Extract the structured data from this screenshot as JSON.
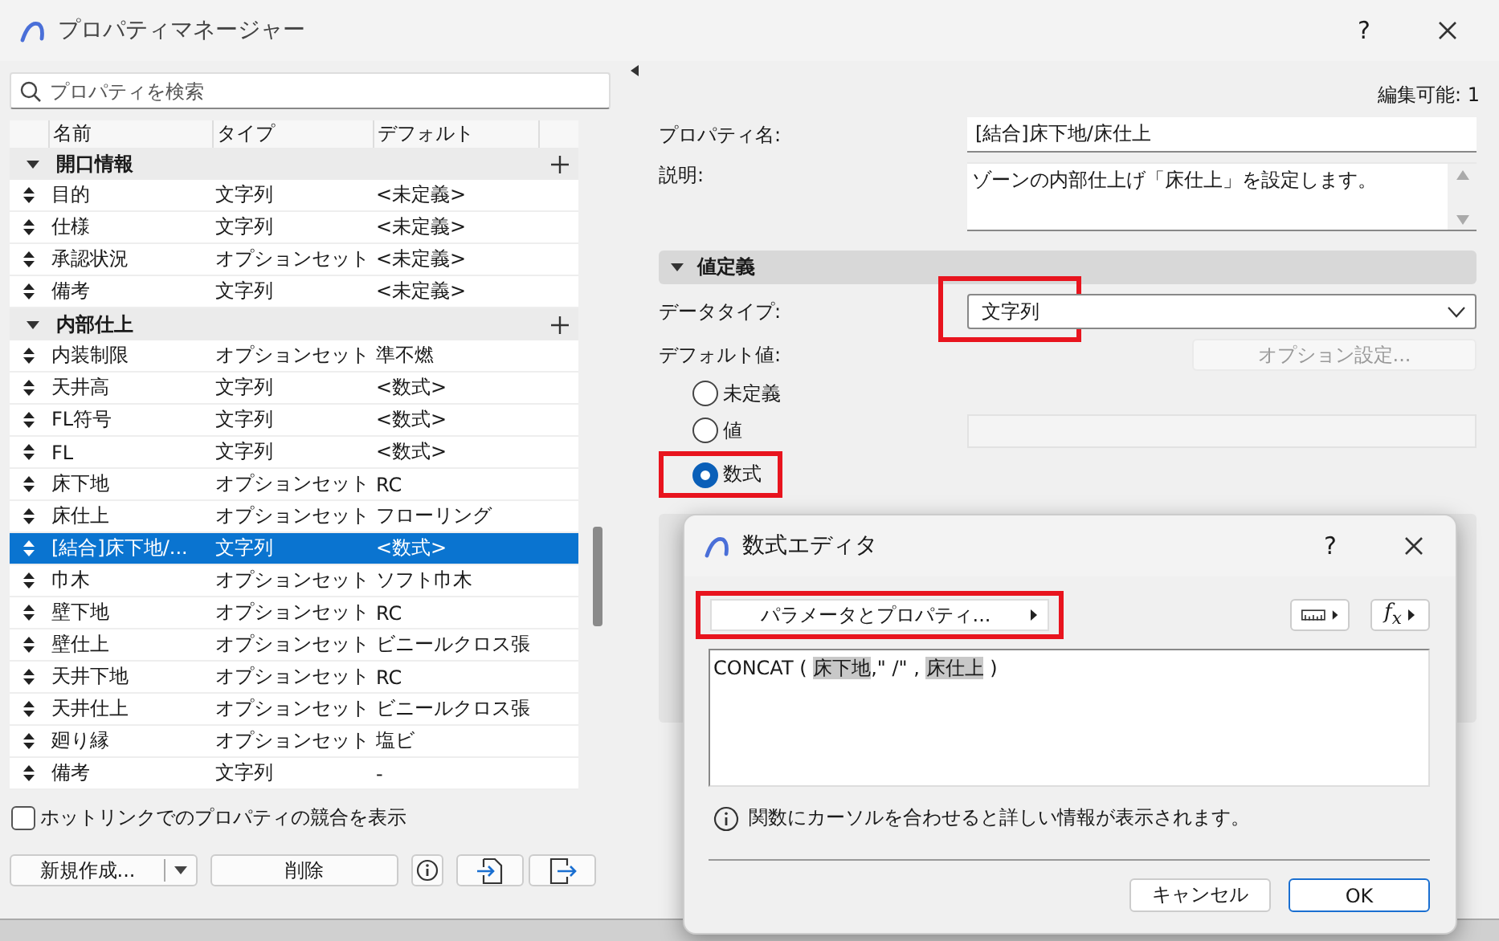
{
  "window": {
    "title": "プロパティマネージャー",
    "help": "?"
  },
  "search": {
    "placeholder": "プロパティを検索"
  },
  "table": {
    "columns": [
      "名前",
      "タイプ",
      "デフォルト"
    ],
    "groups": [
      {
        "name": "開口情報",
        "expanded": true,
        "rows": [
          {
            "name": "目的",
            "type": "文字列",
            "default": "<未定義>",
            "selected": false
          },
          {
            "name": "仕様",
            "type": "文字列",
            "default": "<未定義>",
            "selected": false
          },
          {
            "name": "承認状況",
            "type": "オプションセット",
            "default": "<未定義>",
            "selected": false
          },
          {
            "name": "備考",
            "type": "文字列",
            "default": "<未定義>",
            "selected": false
          }
        ]
      },
      {
        "name": "内部仕上",
        "expanded": true,
        "rows": [
          {
            "name": "内装制限",
            "type": "オプションセット",
            "default": "準不燃",
            "selected": false
          },
          {
            "name": "天井高",
            "type": "文字列",
            "default": "<数式>",
            "selected": false
          },
          {
            "name": "FL符号",
            "type": "文字列",
            "default": "<数式>",
            "selected": false
          },
          {
            "name": "FL",
            "type": "文字列",
            "default": "<数式>",
            "selected": false
          },
          {
            "name": "床下地",
            "type": "オプションセット",
            "default": "RC",
            "selected": false
          },
          {
            "name": "床仕上",
            "type": "オプションセット",
            "default": "フローリング",
            "selected": false
          },
          {
            "name": "[結合]床下地/...",
            "type": "文字列",
            "default": "<数式>",
            "selected": true
          },
          {
            "name": "巾木",
            "type": "オプションセット",
            "default": "ソフト巾木",
            "selected": false
          },
          {
            "name": "壁下地",
            "type": "オプションセット",
            "default": "RC",
            "selected": false
          },
          {
            "name": "壁仕上",
            "type": "オプションセット",
            "default": "ビニールクロス張",
            "selected": false
          },
          {
            "name": "天井下地",
            "type": "オプションセット",
            "default": "RC",
            "selected": false
          },
          {
            "name": "天井仕上",
            "type": "オプションセット",
            "default": "ビニールクロス張",
            "selected": false
          },
          {
            "name": "廻り縁",
            "type": "オプションセット",
            "default": "塩ビ",
            "selected": false
          },
          {
            "name": "備考",
            "type": "文字列",
            "default": "-",
            "selected": false
          }
        ]
      }
    ]
  },
  "hotlink_checkbox": {
    "label": "ホットリンクでのプロパティの競合を表示",
    "checked": false
  },
  "left_buttons": {
    "new": "新規作成...",
    "delete": "削除"
  },
  "details": {
    "editable": "編集可能: 1",
    "property_name": {
      "label": "プロパティ名:",
      "value": "[結合]床下地/床仕上"
    },
    "description": {
      "label": "説明:",
      "value": "ゾーンの内部仕上げ「床仕上」を設定します。"
    },
    "section": {
      "title": "値定義",
      "expanded": true
    },
    "data_type": {
      "label": "データタイプ:",
      "value": "文字列",
      "highlighted": true
    },
    "default_value": {
      "label": "デフォルト値:",
      "options_button": "オプション設定...",
      "options_disabled": true
    },
    "radios": [
      {
        "label": "未定義",
        "selected": false,
        "highlighted": false
      },
      {
        "label": "値",
        "selected": false,
        "highlighted": false
      },
      {
        "label": "数式",
        "selected": true,
        "highlighted": true
      }
    ]
  },
  "dialog": {
    "title": "数式エディタ",
    "help": "?",
    "param_button": {
      "label": "パラメータとプロパティ...",
      "highlighted": true
    },
    "fx_label": "f$_{x}$",
    "formula": [
      {
        "kind": "text",
        "text": "CONCAT ( "
      },
      {
        "kind": "token",
        "text": "床下地"
      },
      {
        "kind": "text",
        "text": ",\" /\" , "
      },
      {
        "kind": "token",
        "text": "床仕上"
      },
      {
        "kind": "text",
        "text": " )"
      }
    ],
    "info": "関数にカーソルを合わせると詳しい情報が表示されます。",
    "buttons": [
      {
        "label": "キャンセル",
        "kind": "secondary"
      },
      {
        "label": "OK",
        "kind": "primary"
      }
    ]
  }
}
